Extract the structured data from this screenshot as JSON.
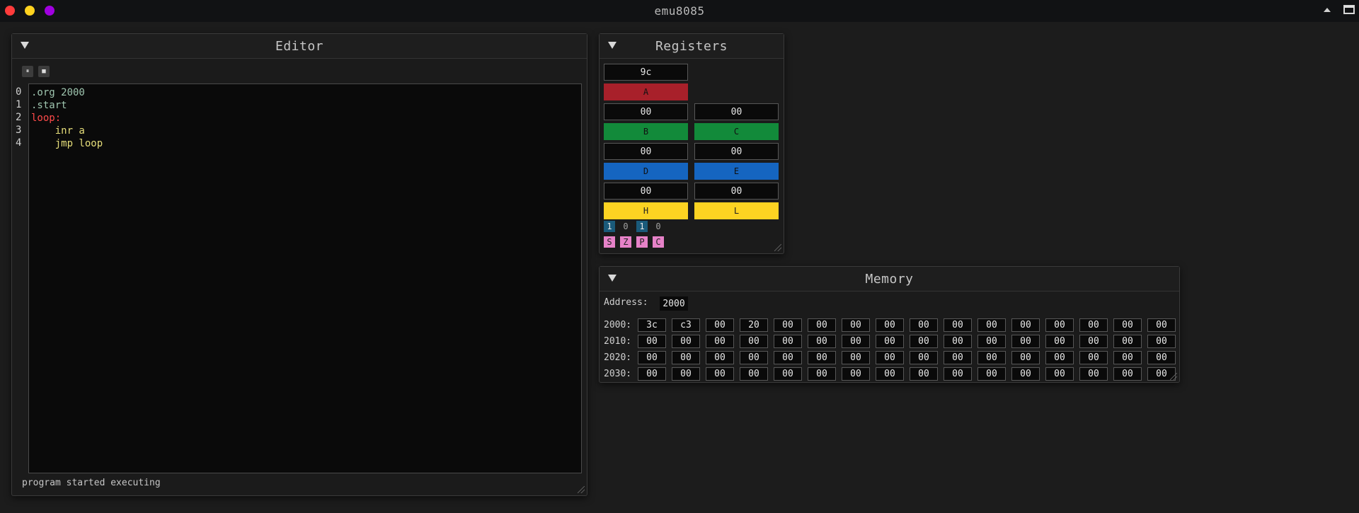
{
  "window": {
    "title": "emu8085",
    "controls_colors": [
      "#ff3b3b",
      "#ffd21f",
      "#a000e0"
    ]
  },
  "editor": {
    "title": "Editor",
    "controls": {
      "pause_label": "⏸",
      "stop_label": "■"
    },
    "line_numbers": [
      "0",
      "1",
      "2",
      "3",
      "4"
    ],
    "lines": [
      {
        "text": ".org 2000",
        "color": "#9fc6b0"
      },
      {
        "text": ".start",
        "color": "#9fc6b0"
      },
      {
        "text": "loop:",
        "color": "#ff4a4a"
      },
      {
        "text": "    inr a",
        "color": "#e6de7a"
      },
      {
        "text": "    jmp loop",
        "color": "#e6de7a"
      }
    ],
    "status": "program started executing"
  },
  "registers": {
    "title": "Registers",
    "accumulator": {
      "value": "9c",
      "name": "A",
      "color": "#a8202a"
    },
    "pairs": [
      {
        "left": {
          "value": "00",
          "name": "B"
        },
        "right": {
          "value": "00",
          "name": "C"
        },
        "color": "#128a3a"
      },
      {
        "left": {
          "value": "00",
          "name": "D"
        },
        "right": {
          "value": "00",
          "name": "E"
        },
        "color": "#1565c0"
      },
      {
        "left": {
          "value": "00",
          "name": "H"
        },
        "right": {
          "value": "00",
          "name": "L"
        },
        "color": "#fcd322"
      }
    ],
    "flags": [
      {
        "name": "S",
        "value": "1",
        "set": true
      },
      {
        "name": "Z",
        "value": "0",
        "set": false
      },
      {
        "name": "P",
        "value": "1",
        "set": true
      },
      {
        "name": "C",
        "value": "0",
        "set": false
      }
    ]
  },
  "memory": {
    "title": "Memory",
    "address_label": "Address:",
    "address_value": "2000",
    "rows": [
      {
        "label": "2000:",
        "cells": [
          "3c",
          "c3",
          "00",
          "20",
          "00",
          "00",
          "00",
          "00",
          "00",
          "00",
          "00",
          "00",
          "00",
          "00",
          "00",
          "00"
        ]
      },
      {
        "label": "2010:",
        "cells": [
          "00",
          "00",
          "00",
          "00",
          "00",
          "00",
          "00",
          "00",
          "00",
          "00",
          "00",
          "00",
          "00",
          "00",
          "00",
          "00"
        ]
      },
      {
        "label": "2020:",
        "cells": [
          "00",
          "00",
          "00",
          "00",
          "00",
          "00",
          "00",
          "00",
          "00",
          "00",
          "00",
          "00",
          "00",
          "00",
          "00",
          "00"
        ]
      },
      {
        "label": "2030:",
        "cells": [
          "00",
          "00",
          "00",
          "00",
          "00",
          "00",
          "00",
          "00",
          "00",
          "00",
          "00",
          "00",
          "00",
          "00",
          "00",
          "00"
        ]
      }
    ]
  }
}
